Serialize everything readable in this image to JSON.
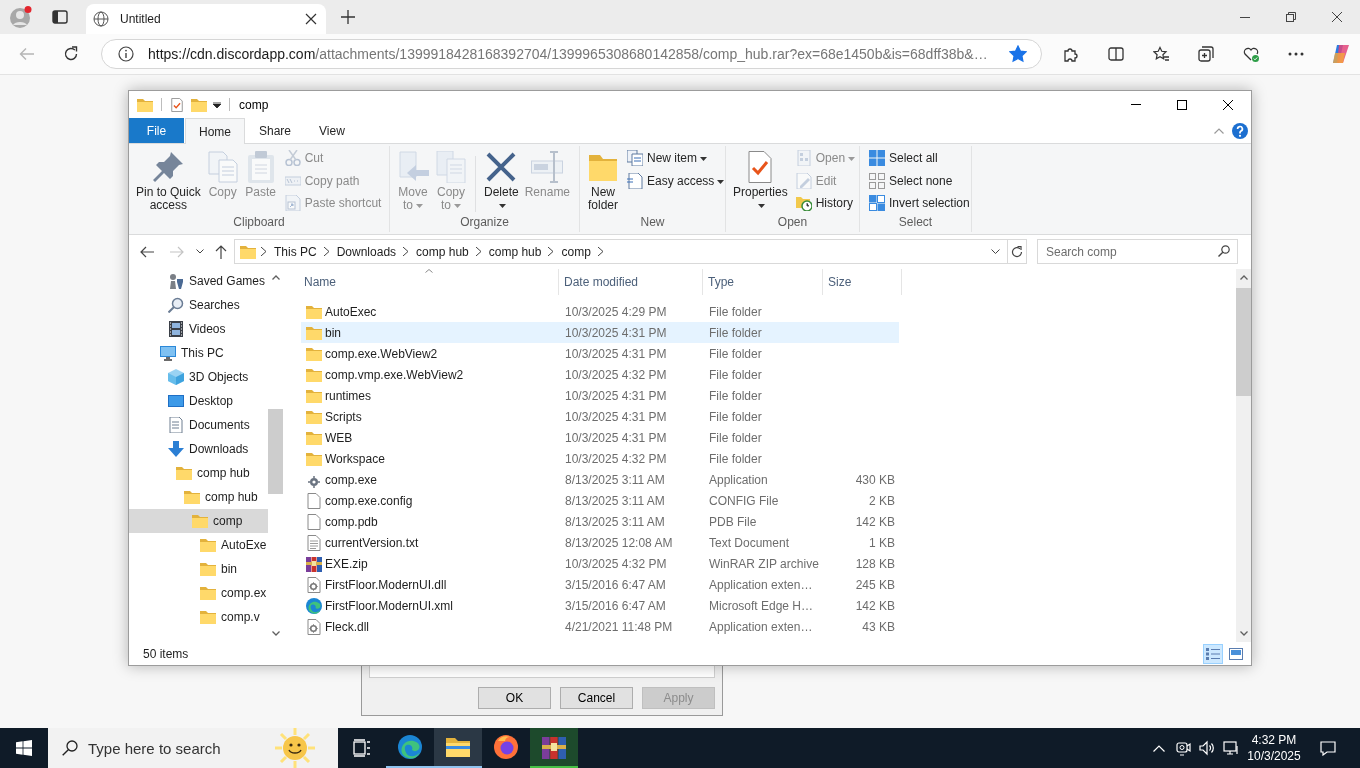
{
  "browser": {
    "tab": {
      "title": "Untitled"
    },
    "address": {
      "origin": "https://cdn.discordapp.com",
      "path": "/attachments/1399918428168392704/1399965308680142858/comp_hub.rar?ex=68e1450b&is=68dff38b&…"
    },
    "favorited": true
  },
  "explorer": {
    "title": "comp",
    "file_tab": "File",
    "tabs": [
      {
        "label": "Home",
        "selected": true
      },
      {
        "label": "Share",
        "selected": false
      },
      {
        "label": "View",
        "selected": false
      }
    ],
    "ribbon": [
      {
        "label": "Clipboard",
        "commands": [
          {
            "kind": "large",
            "label": "Pin to Quick access",
            "disabled": false,
            "dropdown": false
          },
          {
            "kind": "large",
            "label": "Copy",
            "disabled": true,
            "dropdown": false
          },
          {
            "kind": "large",
            "label": "Paste",
            "disabled": true,
            "dropdown": false
          },
          {
            "kind": "small",
            "label": "Cut",
            "disabled": true,
            "dropdown": false
          },
          {
            "kind": "small",
            "label": "Copy path",
            "disabled": true,
            "dropdown": false
          },
          {
            "kind": "small",
            "label": "Paste shortcut",
            "disabled": true,
            "dropdown": false
          }
        ]
      },
      {
        "label": "Organize",
        "commands": [
          {
            "kind": "large",
            "label": "Move to",
            "disabled": true,
            "dropdown": true
          },
          {
            "kind": "large",
            "label": "Copy to",
            "disabled": true,
            "dropdown": true
          },
          {
            "kind": "separator"
          },
          {
            "kind": "large",
            "label": "Delete",
            "disabled": false,
            "dropdown": true
          },
          {
            "kind": "large",
            "label": "Rename",
            "disabled": true,
            "dropdown": false
          }
        ]
      },
      {
        "label": "New",
        "commands": [
          {
            "kind": "large",
            "label": "New folder",
            "disabled": false,
            "dropdown": false
          },
          {
            "kind": "small",
            "label": "New item",
            "disabled": false,
            "dropdown": true
          },
          {
            "kind": "small",
            "label": "Easy access",
            "disabled": false,
            "dropdown": true
          }
        ]
      },
      {
        "label": "Open",
        "commands": [
          {
            "kind": "large",
            "label": "Properties",
            "disabled": false,
            "dropdown": true
          },
          {
            "kind": "small",
            "label": "Open",
            "disabled": true,
            "dropdown": true
          },
          {
            "kind": "small",
            "label": "Edit",
            "disabled": true,
            "dropdown": false
          },
          {
            "kind": "small",
            "label": "History",
            "disabled": false,
            "dropdown": false
          }
        ]
      },
      {
        "label": "Select",
        "commands": [
          {
            "kind": "small",
            "label": "Select all",
            "disabled": false,
            "dropdown": false
          },
          {
            "kind": "small",
            "label": "Select none",
            "disabled": false,
            "dropdown": false
          },
          {
            "kind": "small",
            "label": "Invert selection",
            "disabled": false,
            "dropdown": false
          }
        ]
      }
    ],
    "crumbs": [
      "This PC",
      "Downloads",
      "comp hub",
      "comp hub",
      "comp"
    ],
    "search": {
      "placeholder": "Search comp"
    },
    "nav": [
      {
        "children": [
          {
            "label": "Saved Games",
            "kind": "games",
            "selected": false
          },
          {
            "label": "Searches",
            "kind": "searches",
            "selected": false
          },
          {
            "label": "Videos",
            "kind": "videos",
            "selected": false
          }
        ]
      },
      {
        "label": "This PC",
        "kind": "pc",
        "selected": false,
        "children": [
          {
            "label": "3D Objects",
            "kind": "objects",
            "selected": false
          },
          {
            "label": "Desktop",
            "kind": "desktop",
            "selected": false
          },
          {
            "label": "Documents",
            "kind": "documents",
            "selected": false
          },
          {
            "label": "Downloads",
            "kind": "downloads",
            "selected": false,
            "children": [
              {
                "label": "comp hub",
                "kind": "folder",
                "selected": false,
                "children": [
                  {
                    "label": "comp hub",
                    "kind": "folder",
                    "selected": false,
                    "children": [
                      {
                        "label": "comp",
                        "kind": "folder",
                        "selected": true,
                        "children": [
                          {
                            "label": "AutoExe",
                            "kind": "folder",
                            "selected": false
                          },
                          {
                            "label": "bin",
                            "kind": "folder",
                            "selected": false
                          },
                          {
                            "label": "comp.ex",
                            "kind": "folder",
                            "selected": false
                          },
                          {
                            "label": "comp.v",
                            "kind": "folder",
                            "selected": false
                          }
                        ]
                      }
                    ]
                  }
                ]
              }
            ]
          }
        ]
      }
    ],
    "columns": [
      {
        "label": "Name",
        "sorted": true
      },
      {
        "label": "Date modified",
        "sorted": false
      },
      {
        "label": "Type",
        "sorted": false
      },
      {
        "label": "Size",
        "sorted": false
      }
    ],
    "rows": [
      {
        "name": "AutoExec",
        "date": "10/3/2025 4:29 PM",
        "type": "File folder",
        "kind": "folder",
        "hovered": false
      },
      {
        "name": "bin",
        "date": "10/3/2025 4:31 PM",
        "type": "File folder",
        "kind": "folder",
        "hovered": true
      },
      {
        "name": "comp.exe.WebView2",
        "date": "10/3/2025 4:31 PM",
        "type": "File folder",
        "kind": "folder",
        "hovered": false
      },
      {
        "name": "comp.vmp.exe.WebView2",
        "date": "10/3/2025 4:32 PM",
        "type": "File folder",
        "kind": "folder",
        "hovered": false
      },
      {
        "name": "runtimes",
        "date": "10/3/2025 4:31 PM",
        "type": "File folder",
        "kind": "folder",
        "hovered": false
      },
      {
        "name": "Scripts",
        "date": "10/3/2025 4:31 PM",
        "type": "File folder",
        "kind": "folder",
        "hovered": false
      },
      {
        "name": "WEB",
        "date": "10/3/2025 4:31 PM",
        "type": "File folder",
        "kind": "folder",
        "hovered": false
      },
      {
        "name": "Workspace",
        "date": "10/3/2025 4:32 PM",
        "type": "File folder",
        "kind": "folder",
        "hovered": false
      },
      {
        "name": "comp.exe",
        "date": "8/13/2025 3:11 AM",
        "type": "Application",
        "size": "430 KB",
        "kind": "app",
        "hovered": false
      },
      {
        "name": "comp.exe.config",
        "date": "8/13/2025 3:11 AM",
        "type": "CONFIG File",
        "size": "2 KB",
        "kind": "file",
        "hovered": false
      },
      {
        "name": "comp.pdb",
        "date": "8/13/2025 3:11 AM",
        "type": "PDB File",
        "size": "142 KB",
        "kind": "file",
        "hovered": false
      },
      {
        "name": "currentVersion.txt",
        "date": "8/13/2025 12:08 AM",
        "type": "Text Document",
        "size": "1 KB",
        "kind": "text",
        "hovered": false
      },
      {
        "name": "EXE.zip",
        "date": "10/3/2025 4:32 PM",
        "type": "WinRAR ZIP archive",
        "size": "128 KB",
        "kind": "archive",
        "hovered": false
      },
      {
        "name": "FirstFloor.ModernUI.dll",
        "date": "3/15/2016 6:47 AM",
        "type": "Application exten…",
        "size": "245 KB",
        "kind": "dll",
        "hovered": false
      },
      {
        "name": "FirstFloor.ModernUI.xml",
        "date": "3/15/2016 6:47 AM",
        "type": "Microsoft Edge H…",
        "size": "142 KB",
        "kind": "web",
        "hovered": false
      },
      {
        "name": "Fleck.dll",
        "date": "4/21/2021 11:48 PM",
        "type": "Application exten…",
        "size": "43 KB",
        "kind": "dll",
        "hovered": false
      }
    ],
    "status": "50 items",
    "views": [
      {
        "kind": "details",
        "selected": true
      },
      {
        "kind": "large_icons",
        "selected": false
      }
    ]
  },
  "dialog": {
    "buttons": [
      {
        "label": "OK",
        "disabled": false
      },
      {
        "label": "Cancel",
        "disabled": false
      },
      {
        "label": "Apply",
        "disabled": true
      }
    ]
  },
  "taskbar": {
    "search": {
      "placeholder": "Type here to search"
    },
    "apps": [
      {
        "kind": "browser",
        "running": true,
        "active": false
      },
      {
        "kind": "explorer",
        "running": true,
        "active": true
      },
      {
        "kind": "firefox",
        "running": false,
        "active": false
      },
      {
        "kind": "archiver",
        "running": true,
        "active": false,
        "level": 1
      }
    ],
    "clock": {
      "time": "4:32 PM",
      "date": "10/3/2025"
    }
  }
}
